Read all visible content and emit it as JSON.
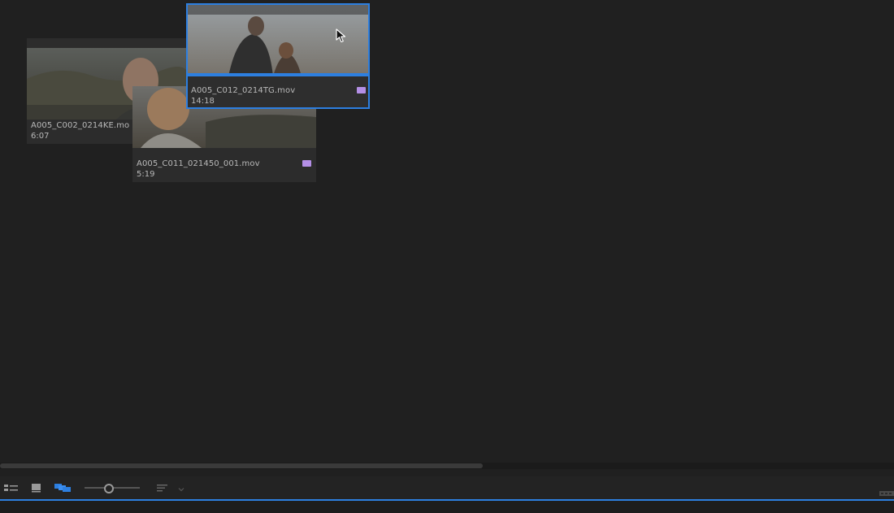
{
  "colors": {
    "selection_border": "#2d7fe0",
    "label_lavender": "#b48fe6",
    "accent_blue": "#2d7fe0"
  },
  "clips": [
    {
      "name": "A005_C002_0214KE.mo",
      "duration": "6:07",
      "selected": false,
      "has_label": false
    },
    {
      "name": "A005_C011_021450_001.mov",
      "duration": "5:19",
      "selected": false,
      "has_label": true
    },
    {
      "name": "A005_C012_0214TG.mov",
      "duration": "14:18",
      "selected": true,
      "has_label": true
    }
  ],
  "toolbar": {
    "list_view_icon": "list-view-icon",
    "icon_view_icon": "icon-view-icon",
    "freeform_view_icon": "freeform-view-icon",
    "zoom_level": 0.42,
    "sort_icon": "sort-icon",
    "sort_dropdown_icon": "chevron-down-icon"
  }
}
